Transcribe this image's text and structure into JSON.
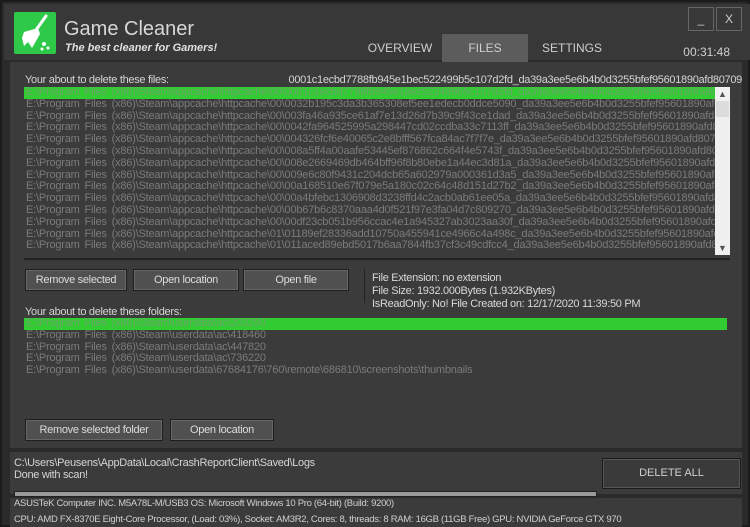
{
  "app": {
    "title": "Game Cleaner",
    "subtitle": "The best cleaner for Gamers!",
    "logo_icon": "broom-icon",
    "accent": "#32cd32",
    "clock": "00:31:48",
    "minimize": "_",
    "close": "X"
  },
  "tabs": [
    {
      "label": "OVERVIEW",
      "active": false
    },
    {
      "label": "FILES",
      "active": true
    },
    {
      "label": "SETTINGS",
      "active": false
    }
  ],
  "files": {
    "label": "Your about to delete these files:",
    "selected_name": "0001c1ecbd7788fb945e1bec522499b5c107d2fd_da39a3ee5e6b4b0d3255bfef95601890afd80709",
    "items": [
      "E:\\Program Files (x86)\\Steam\\appcache\\httpcache\\00\\0001c1ecbd7788fb945e1bec522499b5c107d2fd_da39a3ee5e6b4b0d3255bfef95601890afd8",
      "E:\\Program Files (x86)\\Steam\\appcache\\httpcache\\00\\0032b195c3da3b365308ef5ee1edecb0ddce5090_da39a3ee5e6b4b0d3255bfef95601890afd",
      "E:\\Program Files (x86)\\Steam\\appcache\\httpcache\\00\\003fa46a935ce61af7e13d26d7b39c9f43ce1dad_da39a3ee5e6b4b0d3255bfef95601890afd8",
      "E:\\Program Files (x86)\\Steam\\appcache\\httpcache\\00\\0042fa964525995a298447cd02ccdba33c7113ff_da39a3ee5e6b4b0d3255bfef95601890afd8",
      "E:\\Program Files (x86)\\Steam\\appcache\\httpcache\\00\\004326fcf6e40065c2e8bfff567fca84ac7f7f7e_da39a3ee5e6b4b0d3255bfef95601890afd8070",
      "E:\\Program Files (x86)\\Steam\\appcache\\httpcache\\00\\008a5ff4a00aafe53445ef876862c664f4e5743f_da39a3ee5e6b4b0d3255bfef95601890afd80",
      "E:\\Program Files (x86)\\Steam\\appcache\\httpcache\\00\\008e2669469db464bff96f8b80ebe1a44ec3d81a_da39a3ee5e6b4b0d3255bfef95601890afd8",
      "E:\\Program Files (x86)\\Steam\\appcache\\httpcache\\00\\009e6c80f9431c204dcb65a602979a000361d3a5_da39a3ee5e6b4b0d3255bfef95601890afd",
      "E:\\Program Files (x86)\\Steam\\appcache\\httpcache\\00\\00a168510e67f079e5a180c02c64c48d151d27b2_da39a3ee5e6b4b0d3255bfef95601890afd8",
      "E:\\Program Files (x86)\\Steam\\appcache\\httpcache\\00\\00a4bfebc1306908d3238ffd4c2acb0ab61ee05a_da39a3ee5e6b4b0d3255bfef95601890afd8",
      "E:\\Program Files (x86)\\Steam\\appcache\\httpcache\\00\\00b67b6c8370aaa4d0f521f97e3fa04d7c809270_da39a3ee5e6b4b0d3255bfef95601890afd8",
      "E:\\Program Files (x86)\\Steam\\appcache\\httpcache\\00\\00df23cb051b956ccac4e1a945327ab3023aa30f_da39a3ee5e6b4b0d3255bfef95601890afd8",
      "E:\\Program Files (x86)\\Steam\\appcache\\httpcache\\01\\01189ef28336add10750a455941ce4966c4a498c_da39a3ee5e6b4b0d3255bfef95601890afd",
      "E:\\Program Files (x86)\\Steam\\appcache\\httpcache\\01\\011aced89ebd5017b6aa7844fb37cf3c49cdfcc4_da39a3ee5e6b4b0d3255bfef95601890afd8"
    ]
  },
  "file_buttons": {
    "remove": "Remove selected",
    "open_location": "Open location",
    "open_file": "Open file"
  },
  "file_info": {
    "extension": "File Extension: no extension",
    "size": "File Size: 1932.000Bytes (1.932KBytes)",
    "meta": "IsReadOnly: No!  File Created on: 12/17/2020 11:39:50 PM"
  },
  "folders": {
    "label": "Your about to delete these folders:",
    "items": [
      "E:\\Program Files (x86)\\Steam\\userdata\\ac\\203290",
      "E:\\Program Files (x86)\\Steam\\userdata\\ac\\418460",
      "E:\\Program Files (x86)\\Steam\\userdata\\ac\\447820",
      "E:\\Program Files (x86)\\Steam\\userdata\\ac\\736220",
      "E:\\Program Files (x86)\\Steam\\userdata\\67684176\\760\\remote\\686810\\screenshots\\thumbnails"
    ]
  },
  "folder_buttons": {
    "remove": "Remove selected folder",
    "open_location": "Open location"
  },
  "status": {
    "path": "C:\\Users\\Peusens\\AppData\\Local\\CrashReportClient\\Saved\\Logs",
    "message": "Done with scan!",
    "progress_percent": 100,
    "delete_all": "DELETE ALL"
  },
  "system": {
    "line1": "ASUSTeK Computer INC. M5A78L-M/USB3   OS: Microsoft Windows 10 Pro (64-bit) (Build: 9200)",
    "line2": "CPU: AMD FX-8370E Eight-Core Processor, (Load: 03%), Socket: AM3R2, Cores: 8, threads: 8   RAM: 16GB (11GB Free)   GPU: NVIDIA GeForce GTX 970"
  }
}
